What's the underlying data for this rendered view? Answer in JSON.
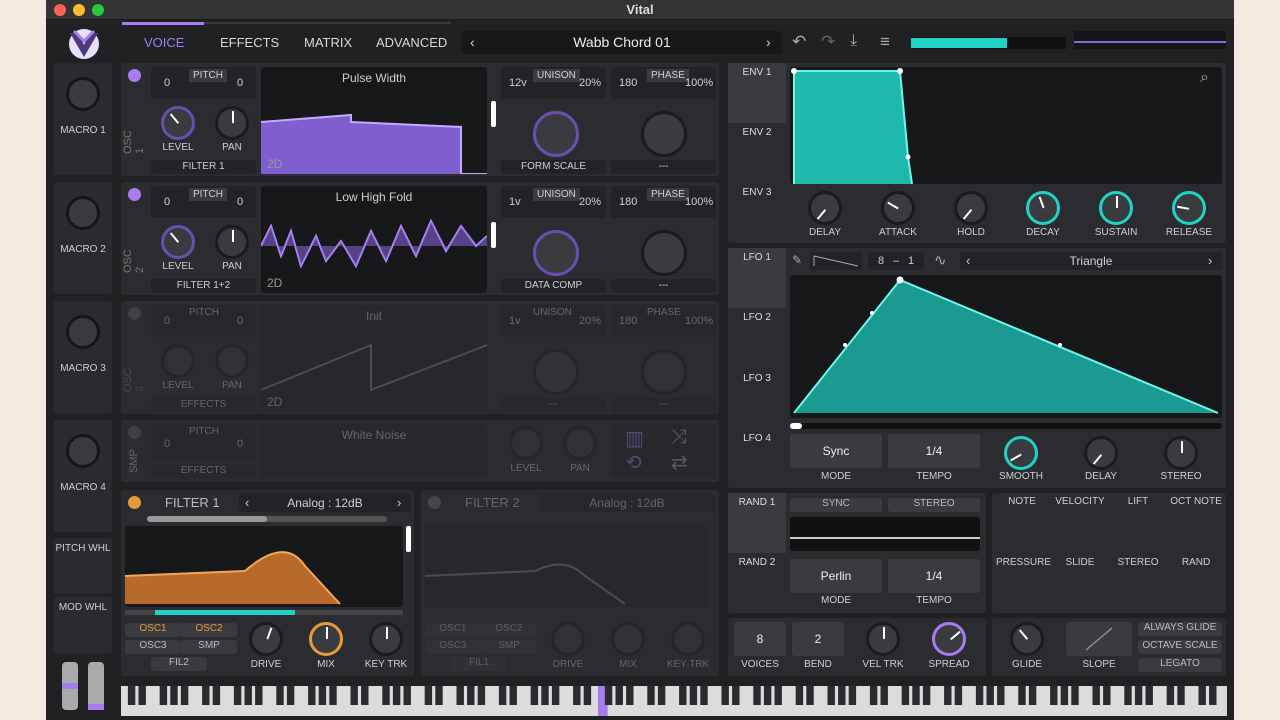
{
  "app": {
    "title": "Vital"
  },
  "colors": {
    "accent": "#a67cf0",
    "teal": "#1fd3c6",
    "orange": "#e59b3a"
  },
  "tabs": [
    "VOICE",
    "EFFECTS",
    "MATRIX",
    "ADVANCED"
  ],
  "preset": {
    "name": "Wabb Chord 01"
  },
  "macros": [
    "MACRO 1",
    "MACRO 2",
    "MACRO 3",
    "MACRO 4"
  ],
  "wheels": {
    "pitch": "PITCH WHL",
    "mod": "MOD WHL"
  },
  "osc": [
    {
      "label": "OSC 1",
      "pitch_l": "0",
      "pitch_title": "PITCH",
      "pitch_r": "0",
      "wave": "Pulse Width",
      "level": "LEVEL",
      "pan": "PAN",
      "dest": "FILTER 1",
      "dim": "2D",
      "unison": "UNISON",
      "voices": "12v",
      "detune": "20%",
      "phase": "PHASE",
      "phase_l": "180",
      "phase_r": "100%",
      "mode": "FORM SCALE",
      "mode2": "---"
    },
    {
      "label": "OSC 2",
      "pitch_l": "0",
      "pitch_title": "PITCH",
      "pitch_r": "0",
      "wave": "Low High Fold",
      "level": "LEVEL",
      "pan": "PAN",
      "dest": "FILTER 1+2",
      "dim": "2D",
      "unison": "UNISON",
      "voices": "1v",
      "detune": "20%",
      "phase": "PHASE",
      "phase_l": "180",
      "phase_r": "100%",
      "mode": "DATA COMP",
      "mode2": "---"
    },
    {
      "label": "OSC 3",
      "pitch_l": "0",
      "pitch_title": "PITCH",
      "pitch_r": "0",
      "wave": "Init",
      "level": "LEVEL",
      "pan": "PAN",
      "dest": "EFFECTS",
      "dim": "2D",
      "unison": "UNISON",
      "voices": "1v",
      "detune": "20%",
      "phase": "PHASE",
      "phase_l": "180",
      "phase_r": "100%",
      "mode": "---",
      "mode2": "---"
    }
  ],
  "smp": {
    "label": "SMP",
    "pitch_title": "PITCH",
    "pitch_l": "0",
    "pitch_r": "0",
    "wave": "White Noise",
    "dest": "EFFECTS",
    "level": "LEVEL",
    "pan": "PAN"
  },
  "filter1": {
    "title": "FILTER 1",
    "type": "Analog : 12dB",
    "osc1": "OSC1",
    "osc2": "OSC2",
    "osc3": "OSC3",
    "smp": "SMP",
    "fil": "FIL2",
    "drive": "DRIVE",
    "mix": "MIX",
    "key": "KEY TRK"
  },
  "filter2": {
    "title": "FILTER 2",
    "type": "Analog : 12dB",
    "osc1": "OSC1",
    "osc2": "OSC2",
    "osc3": "OSC3",
    "smp": "SMP",
    "fil": "FIL1",
    "drive": "DRIVE",
    "mix": "MIX",
    "key": "KEY TRK"
  },
  "env": {
    "tabs": [
      "ENV 1",
      "ENV 2",
      "ENV 3"
    ],
    "knobs": [
      "DELAY",
      "ATTACK",
      "HOLD",
      "DECAY",
      "SUSTAIN",
      "RELEASE"
    ]
  },
  "lfo": {
    "tabs": [
      "LFO 1",
      "LFO 2",
      "LFO 3",
      "LFO 4"
    ],
    "grid_l": "8",
    "grid_sep": "–",
    "grid_r": "1",
    "shape": "Triangle",
    "sync": "Sync",
    "mode": "MODE",
    "tempo_val": "1/4",
    "tempo": "TEMPO",
    "smooth": "SMOOTH",
    "delay": "DELAY",
    "stereo": "STEREO"
  },
  "rand": {
    "tabs": [
      "RAND 1",
      "RAND 2"
    ],
    "sync": "SYNC",
    "stereo": "STEREO",
    "type": "Perlin",
    "mode": "MODE",
    "tempo_val": "1/4",
    "tempo": "TEMPO"
  },
  "mods": [
    "NOTE",
    "VELOCITY",
    "LIFT",
    "OCT NOTE",
    "PRESSURE",
    "SLIDE",
    "STEREO",
    "RAND"
  ],
  "voice": {
    "voices_val": "8",
    "voices": "VOICES",
    "bend_val": "2",
    "bend": "BEND",
    "vel": "VEL TRK",
    "spread": "SPREAD"
  },
  "glide": {
    "glide": "GLIDE",
    "slope": "SLOPE",
    "always": "ALWAYS GLIDE",
    "octave": "OCTAVE SCALE",
    "legato": "LEGATO"
  }
}
